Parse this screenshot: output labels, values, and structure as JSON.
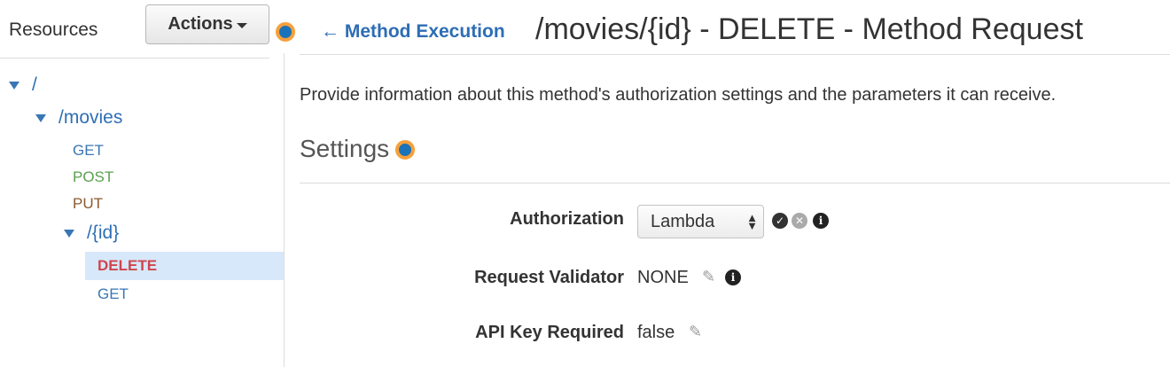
{
  "sidebar": {
    "title": "Resources",
    "actions_label": "Actions",
    "tree": {
      "root": "/",
      "movies": "/movies",
      "movies_get": "GET",
      "movies_post": "POST",
      "movies_put": "PUT",
      "id": "/{id}",
      "id_delete": "DELETE",
      "id_get": "GET"
    }
  },
  "header": {
    "back_label": "← Method Execution",
    "title": "/movies/{id} - DELETE - Method Request"
  },
  "main": {
    "description": "Provide information about this method's authorization settings and the parameters it can receive.",
    "settings_heading": "Settings",
    "authorization": {
      "label": "Authorization",
      "value": "Lambda"
    },
    "request_validator": {
      "label": "Request Validator",
      "value": "NONE"
    },
    "api_key_required": {
      "label": "API Key Required",
      "value": "false"
    }
  },
  "colors": {
    "accent_orange": "#f7a03b",
    "link_blue": "#2d6db5",
    "delete_red": "#d0454d",
    "post_green": "#5aa04f",
    "put_brown": "#8a5a2f",
    "selected_bg": "#d7e8fa"
  },
  "icons": [
    "caret-down-icon",
    "info-dot-icon",
    "tree-expand-icon",
    "check-circle-icon",
    "cancel-circle-icon",
    "info-icon",
    "pencil-icon",
    "select-arrows-icon"
  ]
}
